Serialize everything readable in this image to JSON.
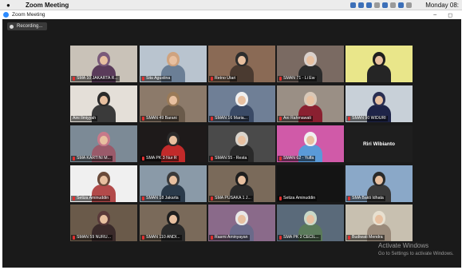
{
  "menubar": {
    "app_name": "Zoom Meeting",
    "clock": "Monday 08:"
  },
  "window": {
    "title": "Zoom Meeting",
    "minimize_glyph": "–",
    "maximize_glyph": "◻"
  },
  "recording": {
    "label": "Recording..."
  },
  "participants": [
    {
      "name": "SMA 10 JAKARTA R...",
      "bg": "#c9c2b8",
      "hijab": "#7a5a7a",
      "body": "#5a3b5a",
      "mic": true
    },
    {
      "name": "Sita Agustina",
      "bg": "#b9c4cf",
      "hijab": "#cfa37f",
      "body": "#6b7f96",
      "mic": true
    },
    {
      "name": "Retno Utari",
      "bg": "#8a6a55",
      "hijab": "#2d2d2d",
      "body": "#4a3a30",
      "mic": true
    },
    {
      "name": "SMAN 71 - Li Ew",
      "bg": "#7a6a62",
      "hijab": "#d9d0cb",
      "body": "#2b2b2b",
      "mic": true
    },
    {
      "name": "",
      "bg": "#e9e68a",
      "hijab": "#1e1e1e",
      "body": "#252525",
      "mic": false
    },
    {
      "name": "Aini Ilmiyyah",
      "bg": "#e4dfd8",
      "hijab": "#2a2a2a",
      "body": "#3a3a3a",
      "mic": false
    },
    {
      "name": "SMAN 49 Barani",
      "bg": "#8c7a6a",
      "hijab": "#9a7a58",
      "body": "#6a5a4a",
      "mic": true
    },
    {
      "name": "SMAN 16 Maria...",
      "bg": "#6f7f96",
      "hijab": "#f0f0f0",
      "body": "#3a4a66",
      "mic": true
    },
    {
      "name": "Ani Rahmawati",
      "bg": "#9a8f85",
      "hijab": "#d8c8b8",
      "body": "#8a2030",
      "mic": true
    },
    {
      "name": "SMAN 90 WIDURI",
      "bg": "#c8d0d8",
      "hijab": "#2a2f52",
      "body": "#1e2448",
      "mic": true
    },
    {
      "name": "SMA KARTINI M...",
      "bg": "#7c8a96",
      "hijab": "#c77a8a",
      "body": "#9a5a6a",
      "mic": true
    },
    {
      "name": "SMA PK 3 Nur R",
      "bg": "#1e1a1a",
      "hijab": "#2a2a2a",
      "body": "#c22a2a",
      "mic": true
    },
    {
      "name": "SMAN 55 - Resta",
      "bg": "#4a4a4a",
      "hijab": "#d9d4cc",
      "body": "#2a2a2a",
      "mic": true
    },
    {
      "name": "SMAN 62 - Yulfa",
      "bg": "#d05aa8",
      "hijab": "#f0f0f0",
      "body": "#5a9ad8",
      "mic": true
    },
    {
      "name": "Riri Wibianto",
      "bg": "#1e1e1e",
      "hijab": "#1e1e1e",
      "body": "#1e1e1e",
      "mic": false,
      "name_only": true
    },
    {
      "name": "Setiza Aminuddin",
      "bg": "#f0f0f0",
      "hijab": "#6a4a3a",
      "body": "#b24a4a",
      "mic": true
    },
    {
      "name": "SMAN 18 Jakarta",
      "bg": "#8a9aa8",
      "hijab": "#3a3a3a",
      "body": "#2a3a4a",
      "mic": true
    },
    {
      "name": "SMA PUSAKA 1 J...",
      "bg": "#7a6a5a",
      "hijab": "#1e1e1e",
      "body": "#2a2a2a",
      "mic": true
    },
    {
      "name": "Setiza Aminuddin",
      "bg": "#141414",
      "hijab": "#141414",
      "body": "#141414",
      "mic": true
    },
    {
      "name": "SMA Bakti Idhata",
      "bg": "#8aa8c8",
      "hijab": "#2a2a2a",
      "body": "#3a3a3a",
      "mic": true
    },
    {
      "name": "SMAN 59 NURU...",
      "bg": "#6a5a4a",
      "hijab": "#5a3a3a",
      "body": "#3a2a2a",
      "mic": true
    },
    {
      "name": "SMAN 110 ANDI...",
      "bg": "#7a6a5a",
      "hijab": "#1e1e1e",
      "body": "#2a2a2a",
      "mic": true
    },
    {
      "name": "Rasmi Aminyayan",
      "bg": "#8a6a8a",
      "hijab": "#e8e8e8",
      "body": "#6a6a8a",
      "mic": true
    },
    {
      "name": "SMA PK 2 CECIL...",
      "bg": "#5a6a7a",
      "hijab": "#c8d8c8",
      "body": "#5a7a5a",
      "mic": true
    },
    {
      "name": "Budiwati Mendra",
      "bg": "#c8c0b0",
      "hijab": "#e8e0d0",
      "body": "#9a8a7a",
      "mic": true
    }
  ],
  "watermark": {
    "line1": "Activate Windows",
    "line2": "Go to Settings to activate Windows."
  }
}
